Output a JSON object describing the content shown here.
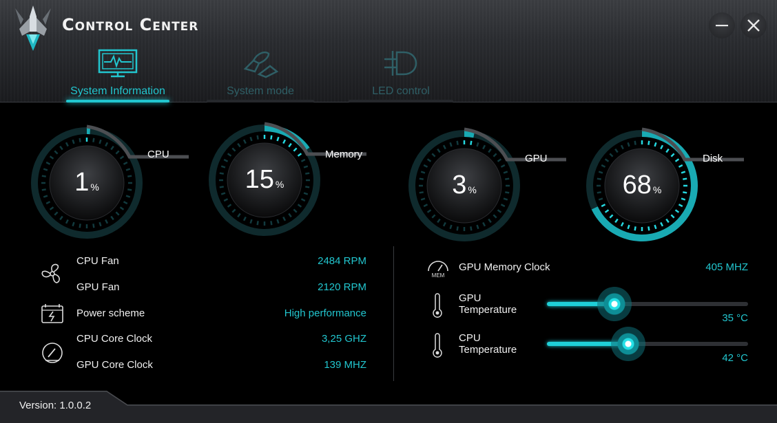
{
  "app": {
    "title": "Control Center"
  },
  "window": {
    "minimize_icon": "minimize-icon",
    "close_icon": "close-icon"
  },
  "tabs": [
    {
      "label": "System Information",
      "icon": "monitor-heartbeat-icon",
      "active": true
    },
    {
      "label": "System mode",
      "icon": "rocket-mode-icon",
      "active": false
    },
    {
      "label": "LED control",
      "icon": "led-bulb-icon",
      "active": false
    }
  ],
  "gauges": [
    {
      "name": "CPU",
      "value": "1",
      "unit": "%",
      "percent": 1
    },
    {
      "name": "Memory",
      "value": "15",
      "unit": "%",
      "percent": 15
    },
    {
      "name": "GPU",
      "value": "3",
      "unit": "%",
      "percent": 3
    },
    {
      "name": "Disk",
      "value": "68",
      "unit": "%",
      "percent": 68
    }
  ],
  "info_left": [
    {
      "label": "CPU Fan",
      "value": "2484 RPM"
    },
    {
      "label": "GPU Fan",
      "value": "2120 RPM"
    },
    {
      "label": "Power scheme",
      "value": "High performance"
    },
    {
      "label": "CPU Core Clock",
      "value": "3,25 GHZ"
    },
    {
      "label": "GPU Core Clock",
      "value": "139 MHZ"
    }
  ],
  "info_right": {
    "gpu_memory_clock": {
      "icon_text": "MEM",
      "label": "GPU Memory Clock",
      "value": "405 MHZ"
    },
    "gpu_temperature": {
      "label_line1": "GPU",
      "label_line2": "Temperature",
      "value": "35 °C",
      "level": 0.35
    },
    "cpu_temperature": {
      "label_line1": "CPU",
      "label_line2": "Temperature",
      "value": "42 °C",
      "level": 0.42
    }
  },
  "footer": {
    "version": "Version: 1.0.0.2"
  },
  "colors": {
    "accent": "#22c6cf",
    "background": "#000000",
    "inactive_tab": "#2f5f66"
  }
}
